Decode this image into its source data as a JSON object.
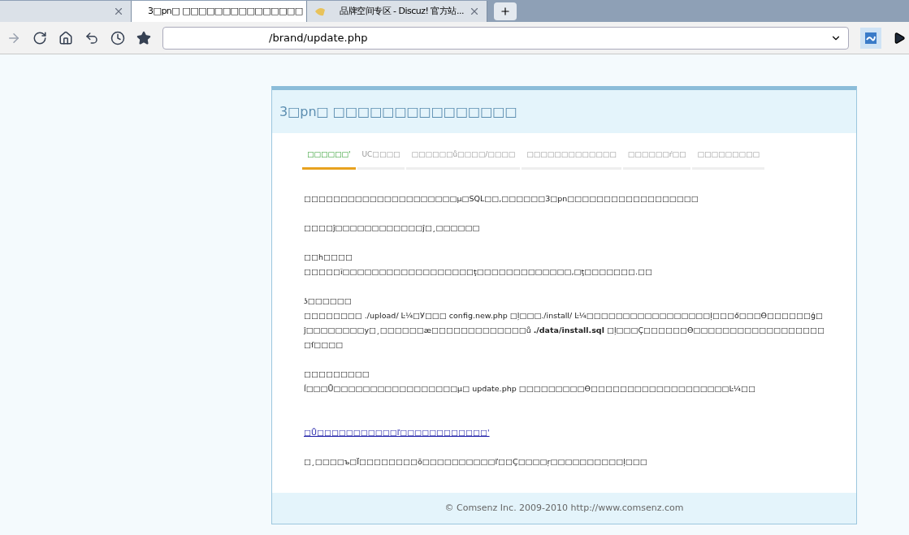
{
  "browser_tabs": [
    {
      "selected": false,
      "kind": "blank"
    },
    {
      "title": "3□pn□ □□□□□□□□□□□□□□□",
      "selected": true,
      "kind": "page"
    },
    {
      "title": "品牌空间专区 - Discuz! 官方站...",
      "selected": false,
      "kind": "favicon"
    }
  ],
  "address": "/brand/update.php",
  "page": {
    "title": "3□pn□ □□□□□□□□□□□□□□□",
    "steps": [
      {
        "label": "□□□□□□'",
        "selected": true
      },
      {
        "label": "UC□□□□",
        "selected": false
      },
      {
        "label": "□□□□□□ů□□□□/□□□□",
        "selected": false
      },
      {
        "label": "□□□□□□□□□□□□□",
        "selected": false
      },
      {
        "label": "□□□□□□ŕ□□",
        "selected": false
      },
      {
        "label": "□□□□□□□□□",
        "selected": false
      }
    ],
    "blocks": [
      {
        "lines": [
          "□□□□□□□□□□□□□□□□□□□□□µ□SQL□□,□□□□□□3□pn□□□□□□□□□□□□□□□□□□"
        ]
      },
      {
        "lines": [
          "□□□□ĵ□□□□□□□□□□□□ĵ□¸□□□□□□"
        ]
      },
      {
        "lines": [
          "□□h□□□□",
          "□□□□□ĭ□□□□□□□□□□□□□□□□□□ţ□□□□□□□□□□□□□‚□ţ□□□□□□□.□□"
        ]
      },
      {
        "lines": [
          "ʖ□□□□□□",
          "□□□□□□□□ ./upload/ Ŀ¼□У□□□ config.new.php □ļ□□□./install/ Ŀ¼□□□□□□□□□□□□□□□□□ļ□□□ő□□□ϴ□□□□□□ǵ□ĵ□□□□□□□□у□¸□□□□□□æ□□□□□□□□□□□□□ů **./data/install.sql** □ļ□□□Ç□□□□□□ϴ□□□□□□□□□□□□□□□□□□□ſ□□□□"
        ]
      },
      {
        "lines": [
          "□□□□□□□□□",
          "ĺ□□□Ǖ□□□□□□□□□□□□□□□□□µ□ update.php □□□□□□□□□ϴ□□□□□□□□□□□□□□□□□□□Ŀ¼□□"
        ]
      }
    ],
    "link": "□Ǖ□□□□□□□□□□□ľ□□□□□□□□□□□□'",
    "note": "□¸□□□□ъ□Ï□□□□□□□□ō□□□□□□□□□□ľ□□Ç□□□□ŗ□□□□□□□□□□ļ□□□",
    "footer": "© Comsenz Inc. 2009-2010 http://www.comsenz.com"
  }
}
